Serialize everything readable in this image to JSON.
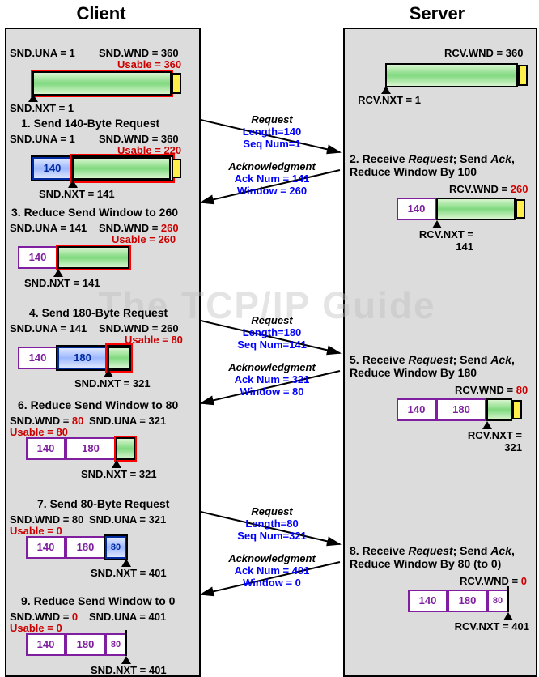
{
  "headers": {
    "client": "Client",
    "server": "Server"
  },
  "watermark": "The TCP/IP Guide",
  "client_steps": {
    "s1": {
      "snd_una": "SND.UNA = 1",
      "snd_wnd": "SND.WND = 360",
      "usable": "Usable = 360",
      "snd_nxt": "SND.NXT = 1",
      "title": "1. Send 140-Byte Request"
    },
    "s2": {
      "snd_una": "SND.UNA = 1",
      "snd_wnd": "SND.WND = 360",
      "usable": "Usable = 220",
      "seg": "140",
      "snd_nxt": "SND.NXT = 141"
    },
    "s3": {
      "title": "3. Reduce Send Window to 260",
      "snd_una": "SND.UNA = 141",
      "snd_wnd": "SND.WND = 260",
      "usable": "Usable = 260",
      "seg": "140",
      "snd_nxt": "SND.NXT = 141"
    },
    "s4": {
      "title": "4. Send 180-Byte Request",
      "snd_una": "SND.UNA = 141",
      "snd_wnd": "SND.WND = 260",
      "usable": "Usable = 80",
      "seg1": "140",
      "seg2": "180",
      "snd_nxt": "SND.NXT = 321"
    },
    "s6": {
      "title": "6. Reduce Send Window to 80",
      "snd_wnd": "SND.WND = 80",
      "usable": "Usable = 80",
      "snd_una": "SND.UNA = 321",
      "seg1": "140",
      "seg2": "180",
      "snd_nxt": "SND.NXT = 321"
    },
    "s7": {
      "title": "7. Send 80-Byte Request",
      "snd_wnd": "SND.WND = 80",
      "usable": "Usable = 0",
      "snd_una": "SND.UNA = 321",
      "seg1": "140",
      "seg2": "180",
      "seg3": "80",
      "snd_nxt": "SND.NXT = 401"
    },
    "s9": {
      "title": "9. Reduce Send Window to 0",
      "snd_wnd": "SND.WND = 0",
      "usable": "Usable = 0",
      "snd_una": "SND.UNA = 401",
      "seg1": "140",
      "seg2": "180",
      "seg3": "80",
      "snd_nxt": "SND.NXT = 401"
    }
  },
  "server_steps": {
    "s0": {
      "rcv_wnd": "RCV.WND = 360",
      "rcv_nxt": "RCV.NXT = 1"
    },
    "s2": {
      "title": "2. Receive Request; Send Ack, Reduce Window By 100",
      "rcv_wnd": "RCV.WND = ",
      "rcv_wnd_val": "260",
      "seg": "140",
      "rcv_nxt": "RCV.NXT = 141"
    },
    "s5": {
      "title": "5. Receive Request; Send Ack, Reduce Window By 180",
      "rcv_wnd": "RCV.WND = ",
      "rcv_wnd_val": "80",
      "seg1": "140",
      "seg2": "180",
      "rcv_nxt": "RCV.NXT = 321"
    },
    "s8": {
      "title": "8. Receive Request; Send Ack, Reduce Window By 80 (to 0)",
      "rcv_wnd": "RCV.WND = ",
      "rcv_wnd_val": "0",
      "seg1": "140",
      "seg2": "180",
      "seg3": "80",
      "rcv_nxt": "RCV.NXT = 401"
    }
  },
  "messages": {
    "m1": {
      "t": "Request",
      "l1": "Length=140",
      "l2": "Seq Num=1"
    },
    "a1": {
      "t": "Acknowledgment",
      "l1": "Ack Num = 141",
      "l2": "Window = 260"
    },
    "m2": {
      "t": "Request",
      "l1": "Length=180",
      "l2": "Seq Num=141"
    },
    "a2": {
      "t": "Acknowledgment",
      "l1": "Ack Num = 321",
      "l2": "Window = 80"
    },
    "m3": {
      "t": "Request",
      "l1": "Length=80",
      "l2": "Seq Num=321"
    },
    "a3": {
      "t": "Acknowledgment",
      "l1": "Ack Num = 401",
      "l2": "Window = 0"
    }
  },
  "chart_data": {
    "type": "diagram",
    "title": "TCP Sliding Window Flow Control Example",
    "client_events": [
      {
        "step": 1,
        "action": "Send Request",
        "length": 140,
        "seq": 1,
        "snd_una": 1,
        "snd_wnd": 360,
        "usable": 360,
        "snd_nxt": 1
      },
      {
        "step": 1.5,
        "snd_una": 1,
        "snd_wnd": 360,
        "usable": 220,
        "snd_nxt": 141
      },
      {
        "step": 3,
        "action": "Reduce Send Window",
        "snd_una": 141,
        "snd_wnd": 260,
        "usable": 260,
        "snd_nxt": 141
      },
      {
        "step": 4,
        "action": "Send Request",
        "length": 180,
        "seq": 141,
        "snd_una": 141,
        "snd_wnd": 260,
        "usable": 80,
        "snd_nxt": 321
      },
      {
        "step": 6,
        "action": "Reduce Send Window",
        "snd_una": 321,
        "snd_wnd": 80,
        "usable": 80,
        "snd_nxt": 321
      },
      {
        "step": 7,
        "action": "Send Request",
        "length": 80,
        "seq": 321,
        "snd_una": 321,
        "snd_wnd": 80,
        "usable": 0,
        "snd_nxt": 401
      },
      {
        "step": 9,
        "action": "Reduce Send Window",
        "snd_una": 401,
        "snd_wnd": 0,
        "usable": 0,
        "snd_nxt": 401
      }
    ],
    "server_events": [
      {
        "step": 0,
        "rcv_wnd": 360,
        "rcv_nxt": 1
      },
      {
        "step": 2,
        "action": "Receive Request; Send Ack",
        "reduce_by": 100,
        "ack": 141,
        "window": 260,
        "rcv_wnd": 260,
        "rcv_nxt": 141
      },
      {
        "step": 5,
        "action": "Receive Request; Send Ack",
        "reduce_by": 180,
        "ack": 321,
        "window": 80,
        "rcv_wnd": 80,
        "rcv_nxt": 321
      },
      {
        "step": 8,
        "action": "Receive Request; Send Ack",
        "reduce_by": 80,
        "ack": 401,
        "window": 0,
        "rcv_wnd": 0,
        "rcv_nxt": 401
      }
    ],
    "messages": [
      {
        "dir": "c2s",
        "type": "Request",
        "length": 140,
        "seq": 1
      },
      {
        "dir": "s2c",
        "type": "Ack",
        "ack": 141,
        "window": 260
      },
      {
        "dir": "c2s",
        "type": "Request",
        "length": 180,
        "seq": 141
      },
      {
        "dir": "s2c",
        "type": "Ack",
        "ack": 321,
        "window": 80
      },
      {
        "dir": "c2s",
        "type": "Request",
        "length": 80,
        "seq": 321
      },
      {
        "dir": "s2c",
        "type": "Ack",
        "ack": 401,
        "window": 0
      }
    ]
  }
}
